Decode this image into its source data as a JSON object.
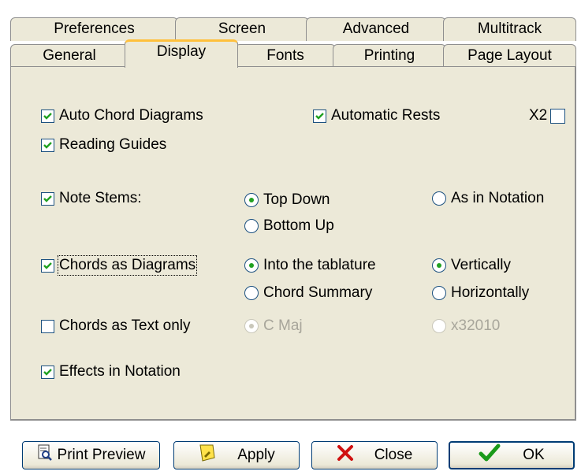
{
  "tabs_row1": [
    {
      "label": "Preferences"
    },
    {
      "label": "Screen"
    },
    {
      "label": "Advanced"
    },
    {
      "label": "Multitrack"
    }
  ],
  "tabs_row2": [
    {
      "label": "General"
    },
    {
      "label": "Display",
      "active": true
    },
    {
      "label": "Fonts"
    },
    {
      "label": "Printing"
    },
    {
      "label": "Page Layout"
    }
  ],
  "options": {
    "auto_chord_diagrams": {
      "label": "Auto Chord Diagrams",
      "checked": true
    },
    "automatic_rests": {
      "label": "Automatic Rests",
      "checked": true
    },
    "x2": {
      "label": "X2",
      "checked": false
    },
    "reading_guides": {
      "label": "Reading Guides",
      "checked": true
    },
    "note_stems": {
      "label": "Note Stems:",
      "checked": true
    },
    "top_down": {
      "label": "Top Down",
      "selected": true
    },
    "as_in_notation": {
      "label": "As in Notation",
      "selected": false
    },
    "bottom_up": {
      "label": "Bottom Up",
      "selected": false
    },
    "chords_as_diagrams": {
      "label": "Chords as Diagrams",
      "checked": true
    },
    "into_tablature": {
      "label": "Into the tablature",
      "selected": true
    },
    "vertically": {
      "label": "Vertically",
      "selected": true
    },
    "chord_summary": {
      "label": "Chord Summary",
      "selected": false
    },
    "horizontally": {
      "label": "Horizontally",
      "selected": false
    },
    "chords_as_text_only": {
      "label": "Chords as Text only",
      "checked": false
    },
    "c_maj": {
      "label": "C Maj",
      "selected": true,
      "disabled": true
    },
    "x32010": {
      "label": "x32010",
      "selected": false,
      "disabled": true
    },
    "effects_in_notation": {
      "label": "Effects in Notation",
      "checked": true
    }
  },
  "buttons": {
    "print_preview": "Print Preview",
    "apply": "Apply",
    "close": "Close",
    "ok": "OK"
  },
  "colors": {
    "accent_tab": "#ffc03c",
    "check": "#21a121",
    "panel": "#ece9d8"
  }
}
